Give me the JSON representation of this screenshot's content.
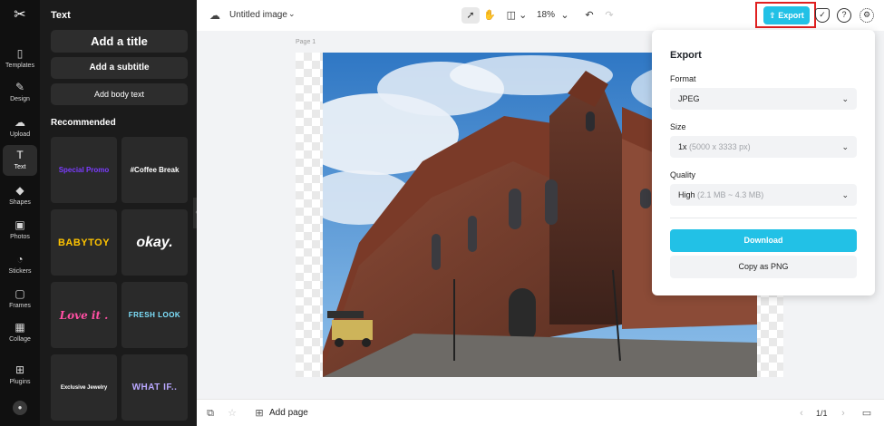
{
  "rail": {
    "logo": "logo",
    "items": [
      {
        "label": "Templates",
        "icon": "templates-icon",
        "glyph": "▯"
      },
      {
        "label": "Design",
        "icon": "design-icon",
        "glyph": "✎"
      },
      {
        "label": "Upload",
        "icon": "upload-icon",
        "glyph": "☁"
      },
      {
        "label": "Text",
        "icon": "text-icon",
        "glyph": "T"
      },
      {
        "label": "Shapes",
        "icon": "shapes-icon",
        "glyph": "◆"
      },
      {
        "label": "Photos",
        "icon": "photos-icon",
        "glyph": "▣"
      },
      {
        "label": "Stickers",
        "icon": "stickers-icon",
        "glyph": "◔"
      },
      {
        "label": "Frames",
        "icon": "frames-icon",
        "glyph": "▢"
      },
      {
        "label": "Collage",
        "icon": "collage-icon",
        "glyph": "▦"
      },
      {
        "label": "Plugins",
        "icon": "plugins-icon",
        "glyph": "⊞"
      }
    ],
    "active": "Text"
  },
  "panel": {
    "title": "Text",
    "add_title": "Add a title",
    "add_subtitle": "Add a subtitle",
    "add_body": "Add body text",
    "recommended": "Recommended",
    "templates": [
      {
        "text": "Special Promo",
        "color": "#7b3cff"
      },
      {
        "text": "#Coffee Break",
        "color": "#ffffff"
      },
      {
        "text": "BABYTOY",
        "color": "#ffc400"
      },
      {
        "text": "okay.",
        "color": "#ffffff"
      },
      {
        "text": "Love it .",
        "color": "#ff4fa3"
      },
      {
        "text": "FRESH LOOK",
        "color": "#7fe3ff"
      },
      {
        "text": "Exclusive Jewelry",
        "color": "#ffffff"
      },
      {
        "text": "WHAT IF..",
        "color": "#b9a7ff"
      }
    ]
  },
  "topbar": {
    "doc_title": "Untitled image",
    "zoom": "18%",
    "export_label": "Export"
  },
  "canvas": {
    "page_label": "Page 1"
  },
  "export_panel": {
    "title": "Export",
    "format_label": "Format",
    "format_value": "JPEG",
    "size_label": "Size",
    "size_value": "1x",
    "size_detail": "(5000 x 3333 px)",
    "quality_label": "Quality",
    "quality_value": "High",
    "quality_detail": "(2.1 MB ~ 4.3 MB)",
    "download_label": "Download",
    "copy_label": "Copy as PNG"
  },
  "bottombar": {
    "add_page": "Add page",
    "pager": "1/1"
  },
  "colors": {
    "accent": "#22c1e6",
    "highlight": "#e02020"
  }
}
